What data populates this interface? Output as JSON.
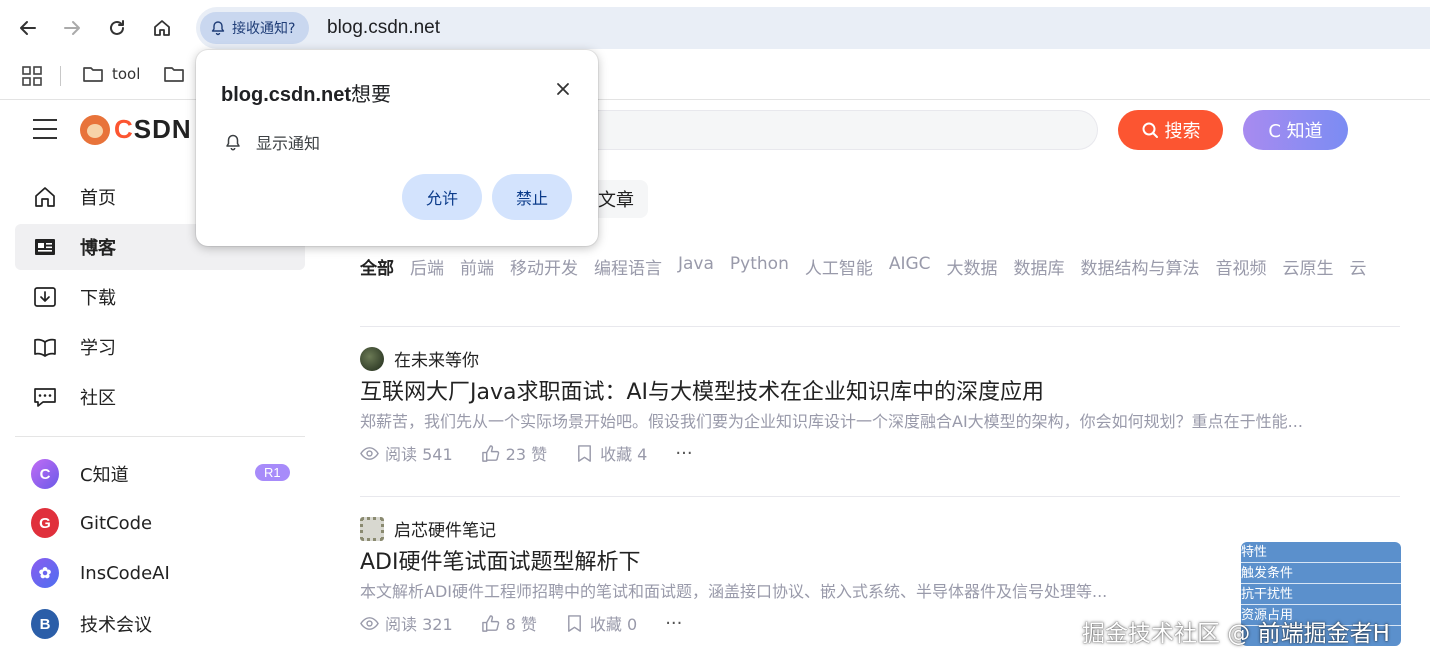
{
  "browser": {
    "notification_chip": "接收通知?",
    "url": "blog.csdn.net",
    "bookmarks": [
      "tool"
    ]
  },
  "permission_popup": {
    "site": "blog.csdn.net",
    "title_suffix": "想要",
    "permission_label": "显示通知",
    "allow_label": "允许",
    "block_label": "禁止"
  },
  "header": {
    "logo_text_c": "C",
    "logo_text_rest": "SDN",
    "search_button": "搜索",
    "zhidao_button": "C 知道",
    "article_tab": "文章"
  },
  "sidebar": {
    "items": [
      {
        "label": "首页"
      },
      {
        "label": "博客"
      },
      {
        "label": "下载"
      },
      {
        "label": "学习"
      },
      {
        "label": "社区"
      }
    ],
    "apps": [
      {
        "label": "C知道",
        "badge": "R1",
        "color": "#7c5cf0"
      },
      {
        "label": "GitCode",
        "color": "#e0303c"
      },
      {
        "label": "InsCodeAI",
        "color": "#6a5ae8"
      },
      {
        "label": "技术会议",
        "color": "#2b5ea8",
        "letter": "B"
      }
    ]
  },
  "categories": [
    "全部",
    "后端",
    "前端",
    "移动开发",
    "编程语言",
    "Java",
    "Python",
    "人工智能",
    "AIGC",
    "大数据",
    "数据库",
    "数据结构与算法",
    "音视频",
    "云原生",
    "云"
  ],
  "articles": [
    {
      "author": "在未来等你",
      "title": "互联网大厂Java求职面试：AI与大模型技术在企业知识库中的深度应用",
      "desc": "郑薪苦，我们先从一个实际场景开始吧。假设我们要为企业知识库设计一个深度融合AI大模型的架构，你会如何规划？重点在于性能...",
      "views": "阅读 541",
      "likes": "23 赞",
      "favs": "收藏 4",
      "more": "···"
    },
    {
      "author": "启芯硬件笔记",
      "title": "ADI硬件笔试面试题型解析下",
      "desc": "本文解析ADI硬件工程师招聘中的笔试和面试题，涵盖接口协议、嵌入式系统、半导体器件及信号处理等...",
      "views": "阅读 321",
      "likes": "8 赞",
      "favs": "收藏 0",
      "more": "···"
    }
  ],
  "thumbnail_rows": [
    "特性",
    "触发条件",
    "抗干扰性",
    "资源占用"
  ],
  "watermark": "掘金技术社区 @ 前端掘金者H",
  "colors": {
    "accent": "#fc5531",
    "chip": "#c9d7ef",
    "popup_button": "#d3e3fd"
  }
}
